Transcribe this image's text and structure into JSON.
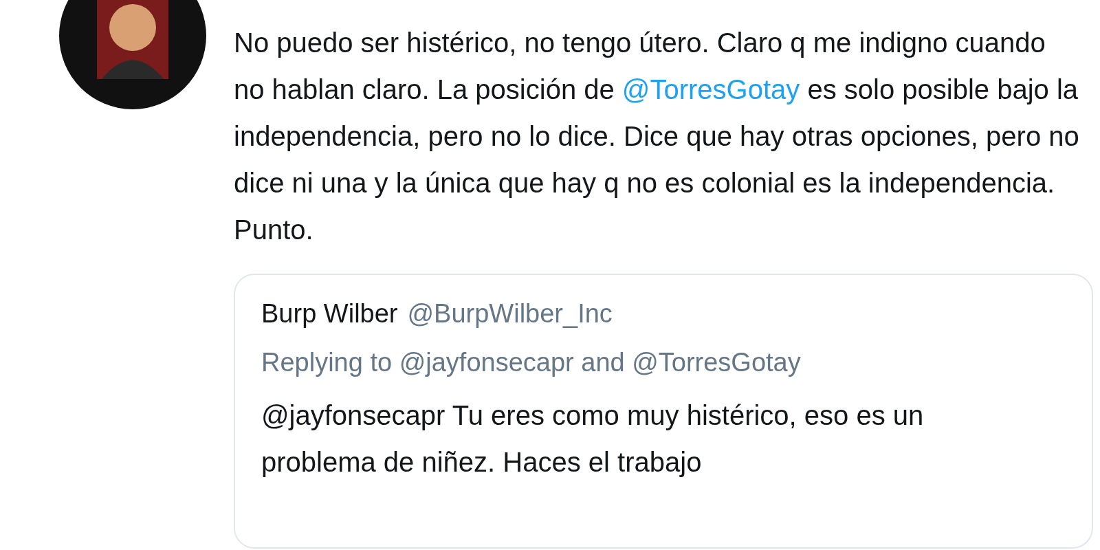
{
  "tweet": {
    "body": [
      {
        "kind": "text",
        "text": "No puedo ser histérico, no tengo útero. Claro q me indigno cuando no hablan claro. La posición de "
      },
      {
        "kind": "mention",
        "text": "@TorresGotay"
      },
      {
        "kind": "text",
        "text": " es solo posible bajo la independencia, pero no lo dice. Dice que hay otras opciones, pero no dice ni una y la única que hay q no es colonial es la independencia. Punto."
      }
    ]
  },
  "quoted_tweet": {
    "name": "Burp Wilber",
    "handle": "@BurpWilber_Inc",
    "replying_to": "Replying to @jayfonsecapr and @TorresGotay",
    "body": "@jayfonsecapr Tu eres como muy histérico, eso es un problema de niñez. Haces el trabajo"
  }
}
